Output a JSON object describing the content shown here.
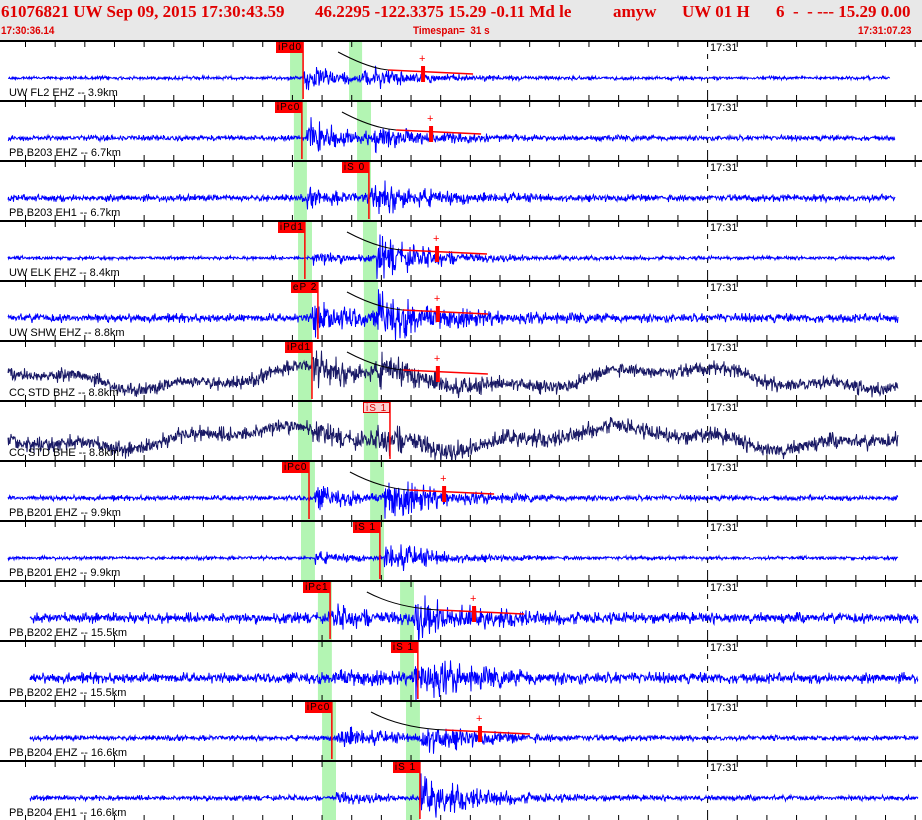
{
  "header": {
    "event": "61076821 UW Sep 09, 2015 17:30:43.59",
    "location": "46.2295 -122.3375 15.29 -0.11 Md le",
    "analyst": "amyw",
    "source": "UW 01 H",
    "extra": "6  -  - --- 15.29 0.00",
    "start_time": "17:30:36.14",
    "timespan": "Timespan=  31 s",
    "end_time": "17:31:07.23"
  },
  "timespan_seconds": 31.09,
  "minute_label": "17:31",
  "minute_offset_seconds": 23.86,
  "colors": {
    "pick": "#ff0000",
    "window": "#b3f5b3",
    "trace": "#0000ff",
    "trace_broadband": "#1a1a66",
    "header_text": "#e00000"
  },
  "channels": [
    {
      "label": "UW FL2 EHZ -- 3.9km",
      "pick": "iPd0",
      "pick_time": 10.22,
      "p_window": [
        9.78,
        10.22
      ],
      "s_window": [
        11.77,
        12.21
      ],
      "selected": true
    },
    {
      "label": "PB B203 EHZ -- 6.7km",
      "pick": "iPc0",
      "pick_time": 10.18,
      "p_window": [
        9.91,
        10.35
      ],
      "s_window": [
        12.04,
        12.51
      ],
      "selected": true
    },
    {
      "label": "PB B203 EH1 -- 6.7km",
      "pick": "iS 0",
      "pick_time": 12.44,
      "p_window": [
        9.91,
        10.35
      ],
      "s_window": [
        12.04,
        12.51
      ],
      "selected": true
    },
    {
      "label": "UW ELK EHZ -- 8.4km",
      "pick": "iPd1",
      "pick_time": 10.28,
      "p_window": [
        10.05,
        10.52
      ],
      "s_window": [
        12.24,
        12.71
      ],
      "selected": true
    },
    {
      "label": "UW SHW EHZ -- 8.8km",
      "pick": "eP 2",
      "pick_time": 10.72,
      "p_window": [
        10.05,
        10.52
      ],
      "s_window": [
        12.27,
        12.75
      ],
      "selected": true
    },
    {
      "label": "CC STD BHZ -- 8.8km",
      "pick": "iPd1",
      "pick_time": 10.52,
      "p_window": [
        10.05,
        10.52
      ],
      "s_window": [
        12.27,
        12.75
      ],
      "selected": true
    },
    {
      "label": "CC STD BHE -- 8.8km",
      "pick": "iS 1",
      "pick_time": 13.15,
      "p_window": [
        10.05,
        10.52
      ],
      "s_window": [
        12.27,
        12.75
      ],
      "selected": false
    },
    {
      "label": "PB B201 EHZ -- 9.9km",
      "pick": "iPc0",
      "pick_time": 10.42,
      "p_window": [
        10.15,
        10.62
      ],
      "s_window": [
        12.48,
        12.95
      ],
      "selected": true
    },
    {
      "label": "PB B201 EH2 -- 9.9km",
      "pick": "iS 1",
      "pick_time": 12.81,
      "p_window": [
        10.15,
        10.62
      ],
      "s_window": [
        12.48,
        12.95
      ],
      "selected": true
    },
    {
      "label": "PB B202 EHZ -- 15.5km",
      "pick": "iPc1",
      "pick_time": 11.13,
      "p_window": [
        10.72,
        11.19
      ],
      "s_window": [
        13.49,
        13.96
      ],
      "selected": true
    },
    {
      "label": "PB B202 EH2 -- 15.5km",
      "pick": "iS 1",
      "pick_time": 14.09,
      "p_window": [
        10.72,
        11.19
      ],
      "s_window": [
        13.49,
        13.96
      ],
      "selected": true
    },
    {
      "label": "PB B204 EHZ -- 16.6km",
      "pick": "iPc0",
      "pick_time": 11.19,
      "p_window": [
        10.86,
        11.33
      ],
      "s_window": [
        13.69,
        14.16
      ],
      "selected": true
    },
    {
      "label": "PB B204 EH1 -- 16.6km",
      "pick": "iS 1",
      "pick_time": 14.16,
      "p_window": [
        10.86,
        11.33
      ],
      "s_window": [
        13.69,
        14.16
      ],
      "selected": true
    }
  ]
}
